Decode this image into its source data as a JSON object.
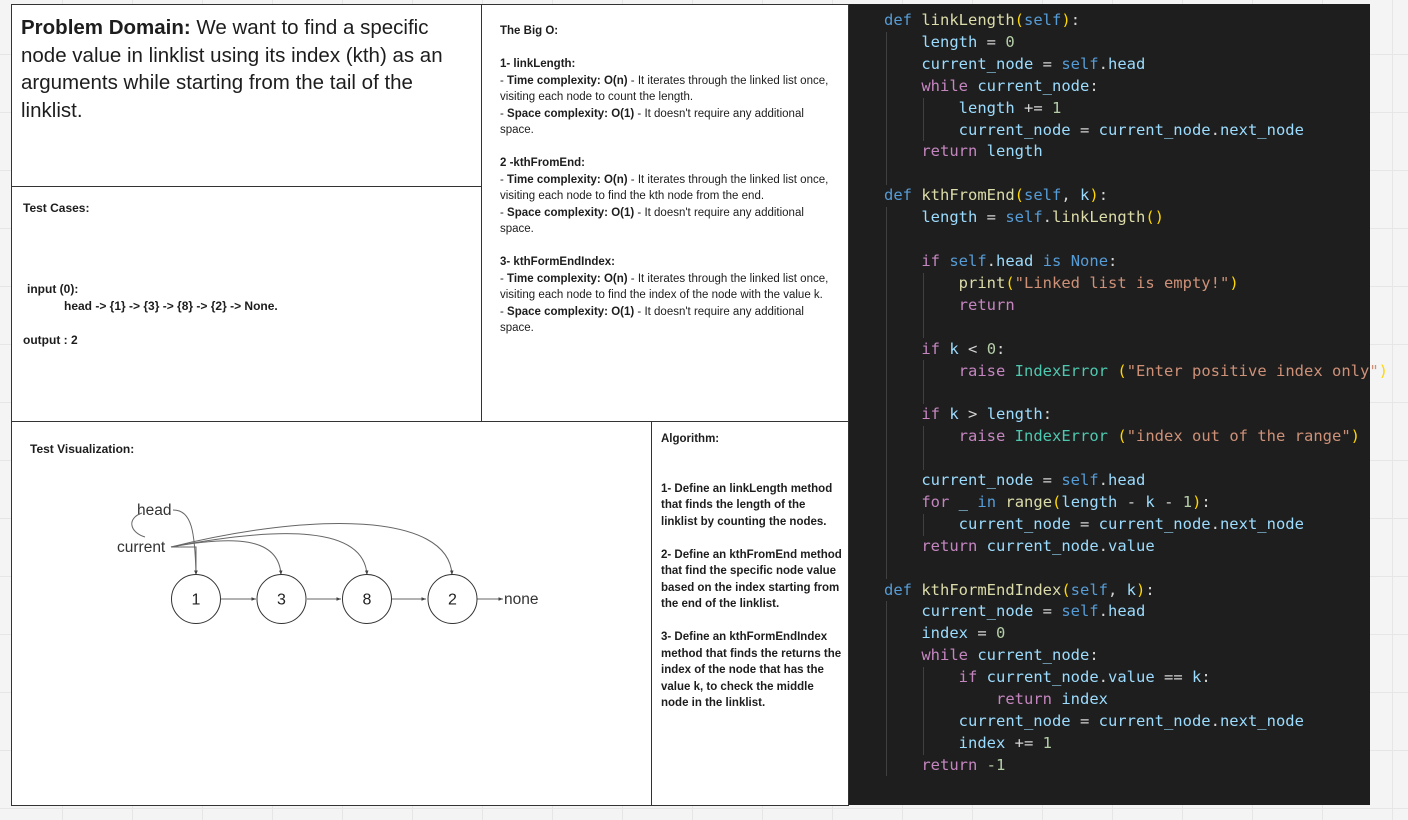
{
  "problem_domain": {
    "label": "Problem Domain:",
    "text": " We want to find a specific node value in linklist using its index (kth) as an arguments while starting from the tail of the linklist."
  },
  "test_cases": {
    "title": "Test Cases:",
    "input_label": "input (0):",
    "input_value": "head -> {1} -> {3} -> {8} -> {2} -> None.",
    "output": "output : 2"
  },
  "big_o": {
    "title": "The Big O:",
    "sections": [
      {
        "heading": "1- linkLength:",
        "time_label": "Time complexity:",
        "time_value": "O(n)",
        "time_desc": " - It iterates through the linked list once, visiting each node to count the length.",
        "space_label": "Space complexity:",
        "space_value": "O(1)",
        "space_desc": " - It doesn't require any additional space."
      },
      {
        "heading": "2 -kthFromEnd:",
        "time_label": "Time complexity:",
        "time_value": "O(n)",
        "time_desc": " - It iterates through the linked list once, visiting each node to find the kth node from the end.",
        "space_label": "Space complexity:",
        "space_value": "O(1)",
        "space_desc": " - It doesn't require any additional space."
      },
      {
        "heading": "3- kthFormEndIndex:",
        "time_label": "Time complexity:",
        "time_value": "O(n)",
        "time_desc": " - It iterates through the linked list once, visiting each node to find the index of the node with the value k.",
        "space_label": "Space complexity:",
        "space_value": "O(1)",
        "space_desc": " - It doesn't require any additional space."
      }
    ]
  },
  "visualization": {
    "title": "Test Visualization:",
    "head_label": "head",
    "current_label": "current",
    "nodes": [
      "1",
      "3",
      "8",
      "2"
    ],
    "end_label": "none"
  },
  "algorithm": {
    "title": "Algorithm:",
    "steps": [
      "1- Define an linkLength method that finds the length of the linklist by counting the nodes.",
      "2- Define an kthFromEnd method that find the specific node value based on the index starting from the end of the linklist.",
      "3- Define an kthFormEndIndex method that finds the returns the index of the node that has the value k, to check the middle node in the linklist."
    ]
  },
  "code": {
    "language": "python",
    "lines": [
      "def linkLength(self):",
      "    length = 0",
      "    current_node = self.head",
      "    while current_node:",
      "        length += 1",
      "        current_node = current_node.next_node",
      "    return length",
      "",
      "def kthFromEnd(self, k):",
      "    length = self.linkLength()",
      "",
      "    if self.head is None:",
      "        print(\"Linked list is empty!\")",
      "        return",
      "",
      "    if k < 0:",
      "        raise IndexError (\"Enter positive index only\")",
      "",
      "    if k > length:",
      "        raise IndexError (\"index out of the range\")",
      "",
      "    current_node = self.head",
      "    for _ in range(length - k - 1):",
      "        current_node = current_node.next_node",
      "    return current_node.value",
      "",
      "def kthFormEndIndex(self, k):",
      "    current_node = self.head",
      "    index = 0",
      "    while current_node:",
      "        if current_node.value == k:",
      "            return index",
      "        current_node = current_node.next_node",
      "        index += 1",
      "    return -1"
    ]
  },
  "colors": {
    "code_background": "#1e1e1e",
    "keyword": "#569cd6",
    "control_keyword": "#c586c0",
    "function_name": "#dcdcaa",
    "variable": "#9cdcfe",
    "number": "#b5cea8",
    "string": "#ce9178",
    "class": "#4ec9b0",
    "bracket": "#ffd700"
  }
}
